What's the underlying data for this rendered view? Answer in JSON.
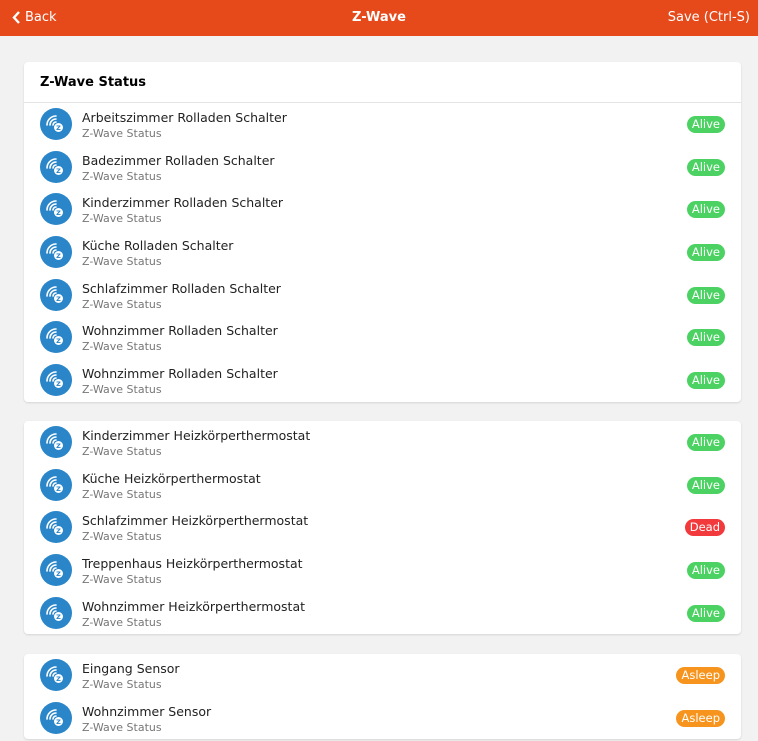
{
  "topbar": {
    "back_label": "Back",
    "title": "Z-Wave",
    "save_label": "Save (Ctrl-S)"
  },
  "colors": {
    "Alive": "#4cd263",
    "Dead": "#f2393c",
    "Asleep": "#f7941d"
  },
  "groups": [
    {
      "title": "Z-Wave Status",
      "items": [
        {
          "name": "Arbeitszimmer Rolladen Schalter",
          "sub": "Z-Wave Status",
          "status": "Alive"
        },
        {
          "name": "Badezimmer Rolladen Schalter",
          "sub": "Z-Wave Status",
          "status": "Alive"
        },
        {
          "name": "Kinderzimmer Rolladen Schalter",
          "sub": "Z-Wave Status",
          "status": "Alive"
        },
        {
          "name": "Küche Rolladen Schalter",
          "sub": "Z-Wave Status",
          "status": "Alive"
        },
        {
          "name": "Schlafzimmer Rolladen Schalter",
          "sub": "Z-Wave Status",
          "status": "Alive"
        },
        {
          "name": "Wohnzimmer Rolladen Schalter",
          "sub": "Z-Wave Status",
          "status": "Alive"
        },
        {
          "name": "Wohnzimmer Rolladen Schalter",
          "sub": "Z-Wave Status",
          "status": "Alive"
        }
      ]
    },
    {
      "items": [
        {
          "name": "Kinderzimmer Heizkörperthermostat",
          "sub": "Z-Wave Status",
          "status": "Alive"
        },
        {
          "name": "Küche Heizkörperthermostat",
          "sub": "Z-Wave Status",
          "status": "Alive"
        },
        {
          "name": "Schlafzimmer Heizkörperthermostat",
          "sub": "Z-Wave Status",
          "status": "Dead"
        },
        {
          "name": "Treppenhaus Heizkörperthermostat",
          "sub": "Z-Wave Status",
          "status": "Alive"
        },
        {
          "name": "Wohnzimmer Heizkörperthermostat",
          "sub": "Z-Wave Status",
          "status": "Alive"
        }
      ]
    },
    {
      "items": [
        {
          "name": "Eingang Sensor",
          "sub": "Z-Wave Status",
          "status": "Asleep"
        },
        {
          "name": "Wohnzimmer Sensor",
          "sub": "Z-Wave Status",
          "status": "Asleep"
        }
      ]
    }
  ]
}
